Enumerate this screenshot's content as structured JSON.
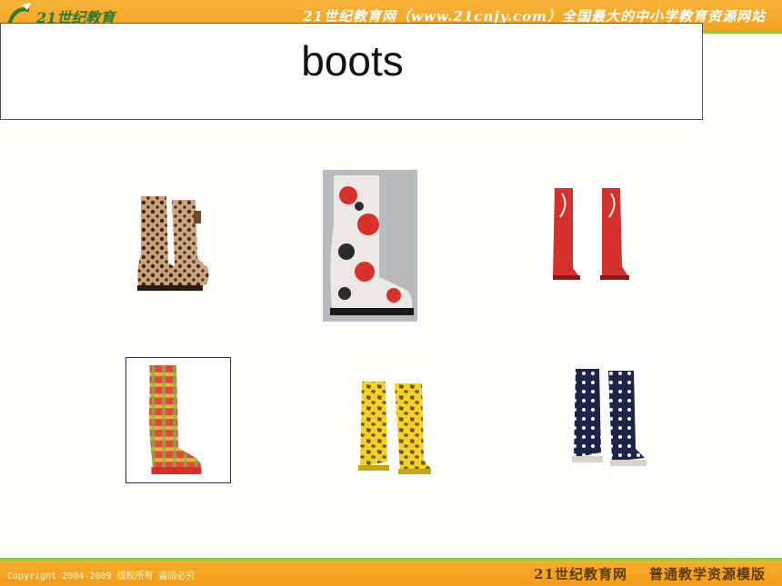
{
  "header": {
    "banner_text": "21世纪教育网（www.21cnjy.com）全国最大的中小学教育资源网站",
    "logo_text": "21世纪教育"
  },
  "slide": {
    "title": "boots"
  },
  "gallery": {
    "items": [
      {
        "icon": "leopard-boot-icon"
      },
      {
        "icon": "floral-boot-icon"
      },
      {
        "icon": "red-boot-icon"
      },
      {
        "icon": "plaid-boot-icon"
      },
      {
        "icon": "yellow-giraffe-boot-icon"
      },
      {
        "icon": "navy-polka-dot-boot-icon"
      }
    ]
  },
  "footer": {
    "copyright": "Copyright 2004-2009 版权所有 盗版必究",
    "site_name": "21世纪教育网",
    "template_name": "普通教学资源模版"
  },
  "colors": {
    "header_orange": "#f3a21f",
    "accent_green": "#9bc73c",
    "background": "#fefdf9"
  }
}
